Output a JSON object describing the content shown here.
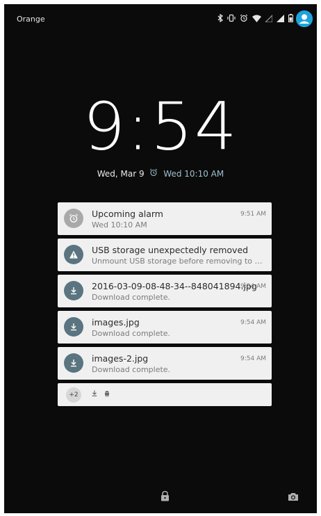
{
  "status_bar": {
    "carrier": "Orange",
    "icons": [
      "bluetooth-icon",
      "vibrate-icon",
      "alarm-icon",
      "wifi-icon",
      "signal-icon",
      "cell-signal-icon",
      "battery-icon"
    ],
    "profile_icon": "profile-avatar-icon"
  },
  "lock_screen": {
    "time": "9:54",
    "date": "Wed, Mar 9",
    "next_alarm": "Wed 10:10 AM"
  },
  "notifications": [
    {
      "icon": "alarm-clock-icon",
      "title": "Upcoming alarm",
      "text": "Wed 10:10 AM",
      "time": "9:51 AM"
    },
    {
      "icon": "warning-icon",
      "title": "USB storage unexpectedly removed",
      "text": "Unmount USB storage before removing to avoid d...",
      "time": ""
    },
    {
      "icon": "download-icon",
      "title": "2016-03-09-08-48-34--848041894.jpg",
      "text": "Download complete.",
      "time": "9:54 AM"
    },
    {
      "icon": "download-icon",
      "title": "images.jpg",
      "text": "Download complete.",
      "time": "9:54 AM"
    },
    {
      "icon": "download-icon",
      "title": "images-2.jpg",
      "text": "Download complete.",
      "time": "9:54 AM"
    }
  ],
  "overflow": {
    "count": "+2",
    "icons": [
      "download-icon",
      "android-icon"
    ]
  },
  "bottom": {
    "left_icon": "lock-icon",
    "right_icon": "camera-icon"
  },
  "colors": {
    "background": "#0b0b0b",
    "notification_bg": "#f0f0f0",
    "accent_blue": "#1ea3dc",
    "icon_circle": "#5a7480"
  }
}
